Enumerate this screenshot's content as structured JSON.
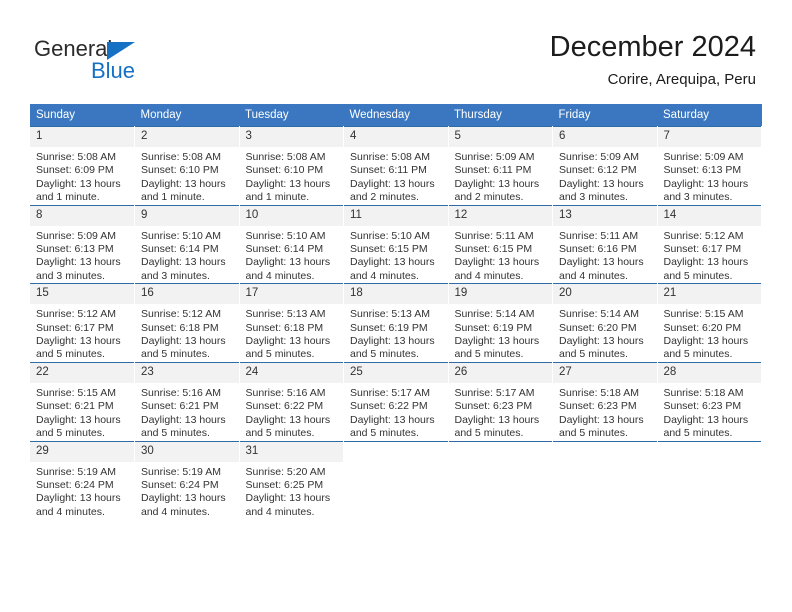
{
  "brand": {
    "name_part1": "General",
    "name_part2": "Blue",
    "triangle_color": "#1671c5"
  },
  "header": {
    "title": "December 2024",
    "subtitle": "Corire, Arequipa, Peru"
  },
  "calendar": {
    "header_bg": "#3a77c0",
    "daynum_bg": "#f2f2f2",
    "weekdays": [
      "Sunday",
      "Monday",
      "Tuesday",
      "Wednesday",
      "Thursday",
      "Friday",
      "Saturday"
    ],
    "weeks": [
      [
        {
          "day": "1",
          "sunrise": "Sunrise: 5:08 AM",
          "sunset": "Sunset: 6:09 PM",
          "daylight": "Daylight: 13 hours and 1 minute."
        },
        {
          "day": "2",
          "sunrise": "Sunrise: 5:08 AM",
          "sunset": "Sunset: 6:10 PM",
          "daylight": "Daylight: 13 hours and 1 minute."
        },
        {
          "day": "3",
          "sunrise": "Sunrise: 5:08 AM",
          "sunset": "Sunset: 6:10 PM",
          "daylight": "Daylight: 13 hours and 1 minute."
        },
        {
          "day": "4",
          "sunrise": "Sunrise: 5:08 AM",
          "sunset": "Sunset: 6:11 PM",
          "daylight": "Daylight: 13 hours and 2 minutes."
        },
        {
          "day": "5",
          "sunrise": "Sunrise: 5:09 AM",
          "sunset": "Sunset: 6:11 PM",
          "daylight": "Daylight: 13 hours and 2 minutes."
        },
        {
          "day": "6",
          "sunrise": "Sunrise: 5:09 AM",
          "sunset": "Sunset: 6:12 PM",
          "daylight": "Daylight: 13 hours and 3 minutes."
        },
        {
          "day": "7",
          "sunrise": "Sunrise: 5:09 AM",
          "sunset": "Sunset: 6:13 PM",
          "daylight": "Daylight: 13 hours and 3 minutes."
        }
      ],
      [
        {
          "day": "8",
          "sunrise": "Sunrise: 5:09 AM",
          "sunset": "Sunset: 6:13 PM",
          "daylight": "Daylight: 13 hours and 3 minutes."
        },
        {
          "day": "9",
          "sunrise": "Sunrise: 5:10 AM",
          "sunset": "Sunset: 6:14 PM",
          "daylight": "Daylight: 13 hours and 3 minutes."
        },
        {
          "day": "10",
          "sunrise": "Sunrise: 5:10 AM",
          "sunset": "Sunset: 6:14 PM",
          "daylight": "Daylight: 13 hours and 4 minutes."
        },
        {
          "day": "11",
          "sunrise": "Sunrise: 5:10 AM",
          "sunset": "Sunset: 6:15 PM",
          "daylight": "Daylight: 13 hours and 4 minutes."
        },
        {
          "day": "12",
          "sunrise": "Sunrise: 5:11 AM",
          "sunset": "Sunset: 6:15 PM",
          "daylight": "Daylight: 13 hours and 4 minutes."
        },
        {
          "day": "13",
          "sunrise": "Sunrise: 5:11 AM",
          "sunset": "Sunset: 6:16 PM",
          "daylight": "Daylight: 13 hours and 4 minutes."
        },
        {
          "day": "14",
          "sunrise": "Sunrise: 5:12 AM",
          "sunset": "Sunset: 6:17 PM",
          "daylight": "Daylight: 13 hours and 5 minutes."
        }
      ],
      [
        {
          "day": "15",
          "sunrise": "Sunrise: 5:12 AM",
          "sunset": "Sunset: 6:17 PM",
          "daylight": "Daylight: 13 hours and 5 minutes."
        },
        {
          "day": "16",
          "sunrise": "Sunrise: 5:12 AM",
          "sunset": "Sunset: 6:18 PM",
          "daylight": "Daylight: 13 hours and 5 minutes."
        },
        {
          "day": "17",
          "sunrise": "Sunrise: 5:13 AM",
          "sunset": "Sunset: 6:18 PM",
          "daylight": "Daylight: 13 hours and 5 minutes."
        },
        {
          "day": "18",
          "sunrise": "Sunrise: 5:13 AM",
          "sunset": "Sunset: 6:19 PM",
          "daylight": "Daylight: 13 hours and 5 minutes."
        },
        {
          "day": "19",
          "sunrise": "Sunrise: 5:14 AM",
          "sunset": "Sunset: 6:19 PM",
          "daylight": "Daylight: 13 hours and 5 minutes."
        },
        {
          "day": "20",
          "sunrise": "Sunrise: 5:14 AM",
          "sunset": "Sunset: 6:20 PM",
          "daylight": "Daylight: 13 hours and 5 minutes."
        },
        {
          "day": "21",
          "sunrise": "Sunrise: 5:15 AM",
          "sunset": "Sunset: 6:20 PM",
          "daylight": "Daylight: 13 hours and 5 minutes."
        }
      ],
      [
        {
          "day": "22",
          "sunrise": "Sunrise: 5:15 AM",
          "sunset": "Sunset: 6:21 PM",
          "daylight": "Daylight: 13 hours and 5 minutes."
        },
        {
          "day": "23",
          "sunrise": "Sunrise: 5:16 AM",
          "sunset": "Sunset: 6:21 PM",
          "daylight": "Daylight: 13 hours and 5 minutes."
        },
        {
          "day": "24",
          "sunrise": "Sunrise: 5:16 AM",
          "sunset": "Sunset: 6:22 PM",
          "daylight": "Daylight: 13 hours and 5 minutes."
        },
        {
          "day": "25",
          "sunrise": "Sunrise: 5:17 AM",
          "sunset": "Sunset: 6:22 PM",
          "daylight": "Daylight: 13 hours and 5 minutes."
        },
        {
          "day": "26",
          "sunrise": "Sunrise: 5:17 AM",
          "sunset": "Sunset: 6:23 PM",
          "daylight": "Daylight: 13 hours and 5 minutes."
        },
        {
          "day": "27",
          "sunrise": "Sunrise: 5:18 AM",
          "sunset": "Sunset: 6:23 PM",
          "daylight": "Daylight: 13 hours and 5 minutes."
        },
        {
          "day": "28",
          "sunrise": "Sunrise: 5:18 AM",
          "sunset": "Sunset: 6:23 PM",
          "daylight": "Daylight: 13 hours and 5 minutes."
        }
      ],
      [
        {
          "day": "29",
          "sunrise": "Sunrise: 5:19 AM",
          "sunset": "Sunset: 6:24 PM",
          "daylight": "Daylight: 13 hours and 4 minutes."
        },
        {
          "day": "30",
          "sunrise": "Sunrise: 5:19 AM",
          "sunset": "Sunset: 6:24 PM",
          "daylight": "Daylight: 13 hours and 4 minutes."
        },
        {
          "day": "31",
          "sunrise": "Sunrise: 5:20 AM",
          "sunset": "Sunset: 6:25 PM",
          "daylight": "Daylight: 13 hours and 4 minutes."
        },
        {
          "day": "",
          "sunrise": "",
          "sunset": "",
          "daylight": ""
        },
        {
          "day": "",
          "sunrise": "",
          "sunset": "",
          "daylight": ""
        },
        {
          "day": "",
          "sunrise": "",
          "sunset": "",
          "daylight": ""
        },
        {
          "day": "",
          "sunrise": "",
          "sunset": "",
          "daylight": ""
        }
      ]
    ]
  }
}
